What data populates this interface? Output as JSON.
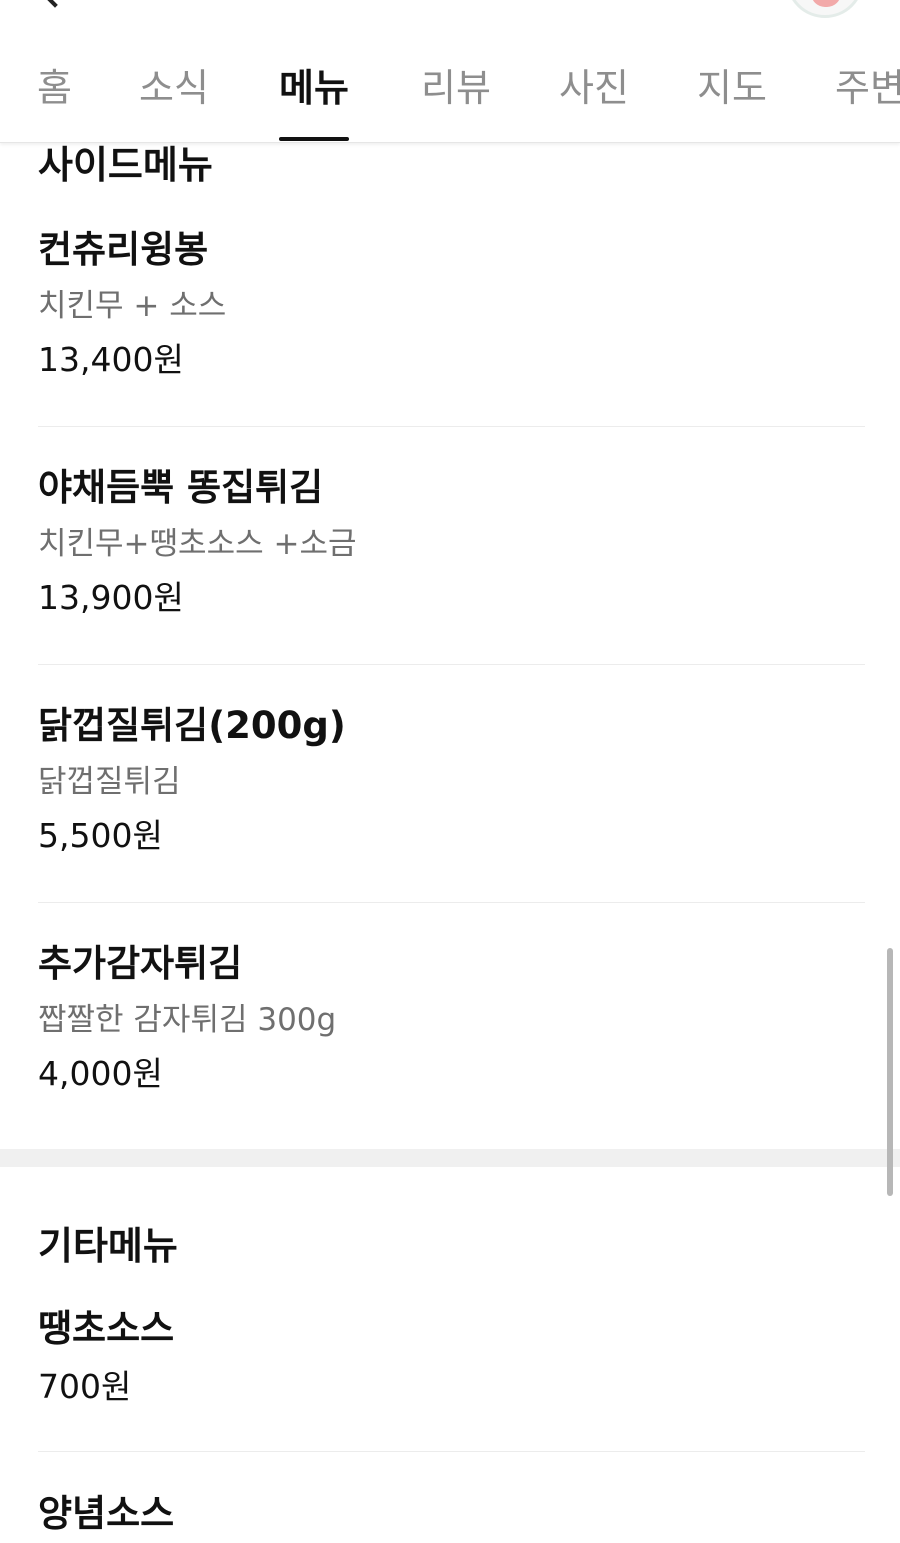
{
  "tabs": [
    {
      "label": "홈",
      "active": false
    },
    {
      "label": "소식",
      "active": false
    },
    {
      "label": "메뉴",
      "active": true
    },
    {
      "label": "리뷰",
      "active": false
    },
    {
      "label": "사진",
      "active": false
    },
    {
      "label": "지도",
      "active": false
    },
    {
      "label": "주변",
      "active": false
    }
  ],
  "sections": [
    {
      "title": "사이드메뉴",
      "items": [
        {
          "name": "컨츄리윙봉",
          "description": "치킨무 + 소스",
          "price": "13,400원"
        },
        {
          "name": "야채듬뿍 똥집튀김",
          "description": "치킨무+땡초소스 +소금",
          "price": "13,900원"
        },
        {
          "name": "닭껍질튀김(200g)",
          "description": "닭껍질튀김",
          "price": "5,500원"
        },
        {
          "name": "추가감자튀김",
          "description": "짭짤한 감자튀김 300g",
          "price": "4,000원"
        }
      ]
    },
    {
      "title": "기타메뉴",
      "items": [
        {
          "name": "땡초소스",
          "price": "700원"
        },
        {
          "name": "양념소스"
        }
      ]
    }
  ],
  "icons": {
    "back": "chevron-left-icon",
    "profile": "avatar"
  },
  "colors": {
    "active_tab": "#111111",
    "inactive_tab": "#8e8e8e",
    "description": "#6f6f6f",
    "section_gap": "#f0f0f0"
  }
}
